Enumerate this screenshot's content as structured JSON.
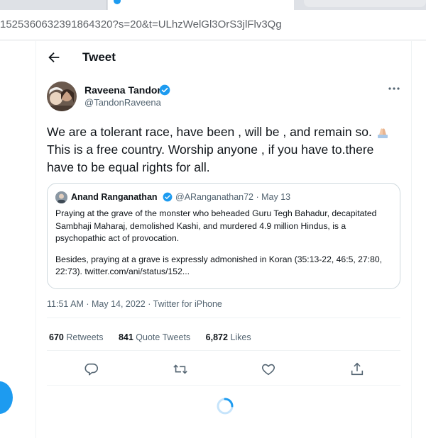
{
  "browser": {
    "url": "1525360632391864320?s=20&t=ULhzWelGl3OrS3jlFlv3Qg"
  },
  "header": {
    "title": "Tweet"
  },
  "tweet": {
    "author_name": "Raveena Tandon",
    "author_handle": "@TandonRaveena",
    "text_part1": "We are a tolerant race, have been , will be , and remain so. ",
    "text_part2": " This is a free country. Worship anyone , if you have to.there have to be equal rights for all.",
    "timestamp": "11:51 AM · May 14, 2022 · Twitter for iPhone",
    "stats": {
      "retweets_count": "670",
      "retweets_label": "Retweets",
      "quote_count": "841",
      "quote_label": "Quote Tweets",
      "likes_count": "6,872",
      "likes_label": "Likes"
    }
  },
  "quoted_tweet": {
    "author_name": "Anand Ranganathan",
    "meta": "@ARanganathan72 · May 13",
    "paragraph1": "Praying at the grave of the monster who beheaded Guru Tegh Bahadur, decapitated Sambhaji Maharaj, demolished Kashi, and murdered 4.9 million Hindus, is a psychopathic act of provocation.",
    "paragraph2": "Besides, praying at a grave is expressly admonished in Koran (35:13-22, 46:5, 27:80, 22:73). twitter.com/ani/status/152..."
  },
  "icons": {
    "back": "arrow-left-icon",
    "more": "more-dots-icon",
    "reply": "reply-icon",
    "retweet": "retweet-icon",
    "like": "heart-icon",
    "share": "share-icon"
  },
  "colors": {
    "accent": "#1d9bf0",
    "secondary_text": "#536471",
    "border": "#cfd9de"
  }
}
